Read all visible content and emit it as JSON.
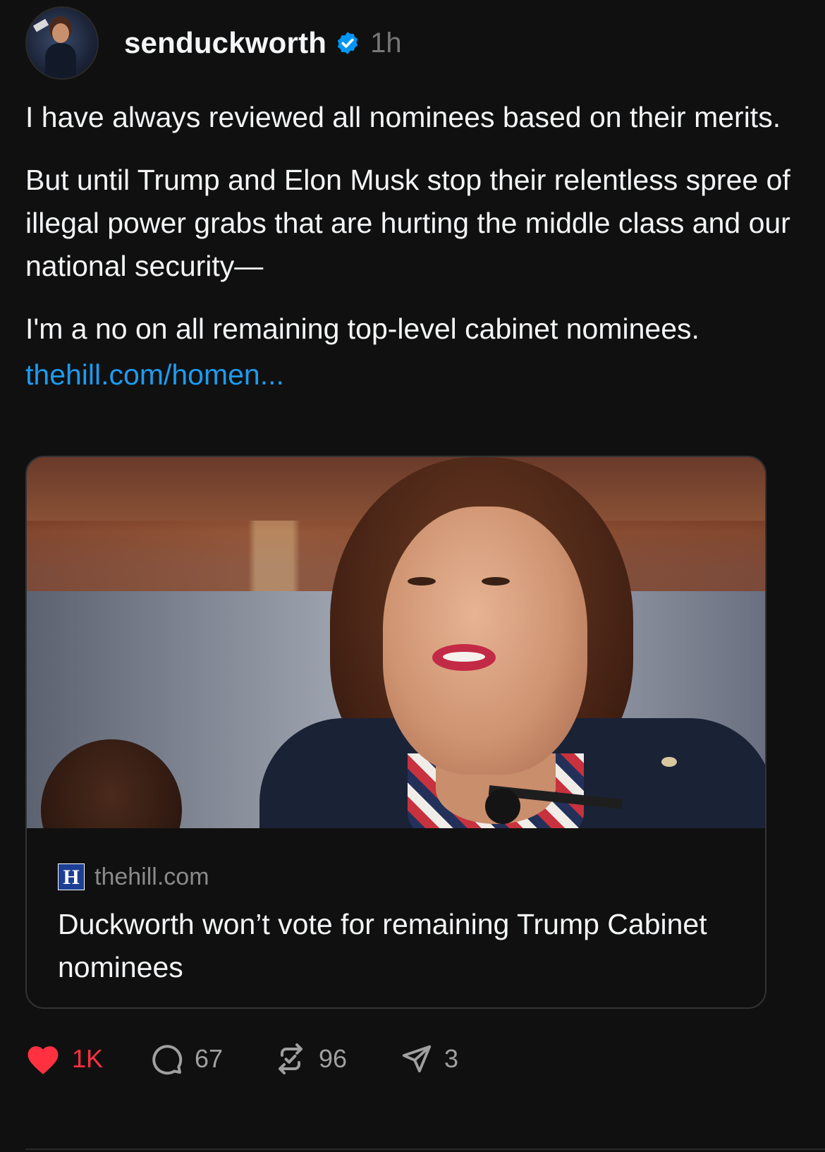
{
  "post": {
    "username": "senduckworth",
    "verified": true,
    "timestamp": "1h",
    "paragraphs": [
      "I have always reviewed all nominees based on their merits.",
      "But until Trump and Elon Musk stop their relentless spree of illegal power grabs that are hurting the middle class and our national security—",
      "I'm a no on all remaining top-level cabinet nominees."
    ],
    "link_text": "thehill.com/homen..."
  },
  "link_card": {
    "source_logo_letter": "H",
    "source_domain": "thehill.com",
    "title": "Duckworth won’t vote for remaining Trump Cabinet nominees"
  },
  "actions": {
    "likes": "1K",
    "replies": "67",
    "reposts": "96",
    "shares": "3"
  },
  "icons": {
    "verified": "verified-badge-icon",
    "like": "heart-filled-icon",
    "reply": "comment-bubble-icon",
    "repost": "repost-icon",
    "share": "send-icon"
  },
  "colors": {
    "background": "#101010",
    "text": "#f3f5f7",
    "muted": "#777777",
    "link": "#1d9bf0",
    "like": "#ff3040",
    "verified": "#0095f6",
    "source_logo": "#1c3f95"
  }
}
